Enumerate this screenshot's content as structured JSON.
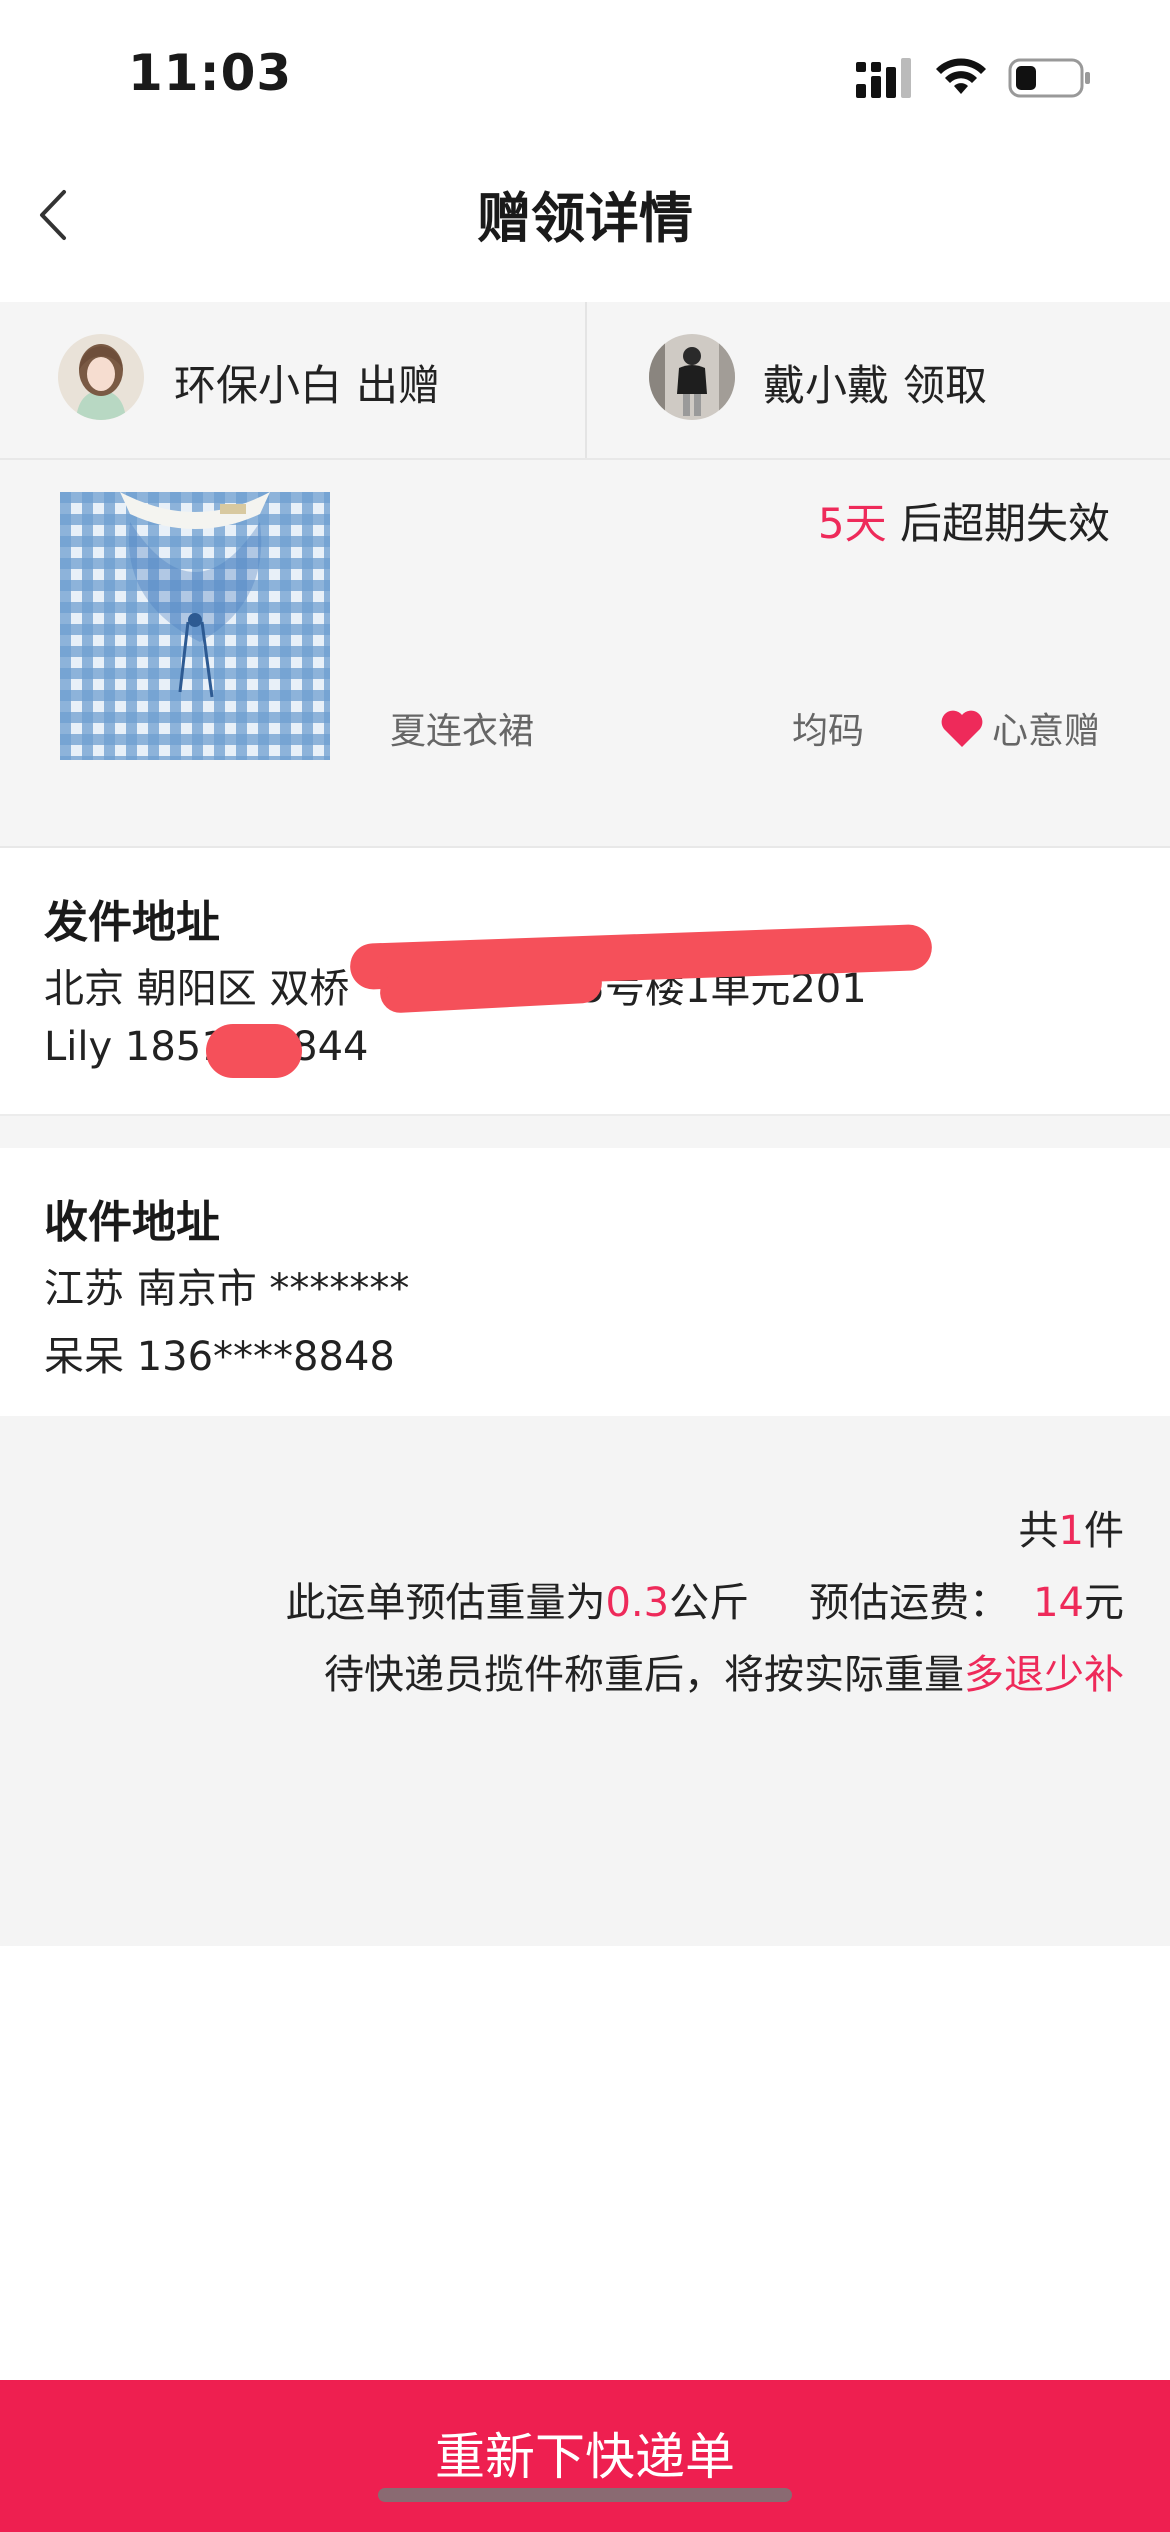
{
  "status_bar": {
    "time": "11:03"
  },
  "nav": {
    "title": "赠领详情"
  },
  "users": {
    "giver": {
      "name": "环保小白",
      "action": "出赠"
    },
    "receiver": {
      "name": "戴小戴",
      "action": "领取"
    }
  },
  "item": {
    "expire_num": "5天",
    "expire_text": "后超期失效",
    "name": "夏连衣裙",
    "size": "均码",
    "gift_type": "心意赠"
  },
  "sender_address": {
    "title": "发件地址",
    "line1_visible_start": "北京 朝阳区 双桥",
    "line1_visible_end": "5号楼1单元201",
    "contact_start": "Lily 1851",
    "contact_end": "9844"
  },
  "receiver_address": {
    "title": "收件地址",
    "line1": "江苏 南京市 *******",
    "contact": "呆呆 136****8848"
  },
  "summary": {
    "count_prefix": "共",
    "count": "1",
    "count_suffix": "件",
    "weight_prefix": "此运单预估重量为",
    "weight": "0.3",
    "weight_unit": "公斤",
    "fee_prefix": "预估运费：",
    "fee": "14",
    "fee_unit": "元",
    "note_prefix": "待快递员揽件称重后，将按实际重量",
    "note_highlight": "多退少补"
  },
  "bottom_button": {
    "label": "重新下快递单"
  },
  "colors": {
    "accent": "#ee2a5a",
    "button": "#ee1f50",
    "redaction": "#f5505a"
  }
}
